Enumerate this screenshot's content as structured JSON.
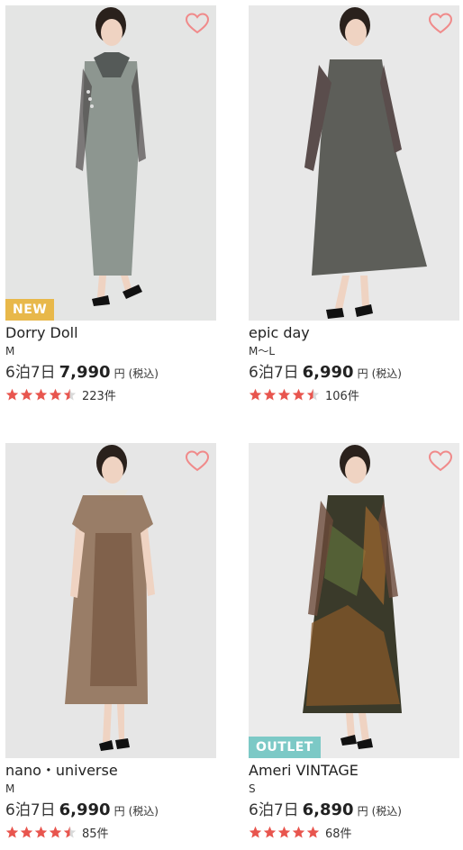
{
  "accent": {
    "heart": "#f08a8a",
    "star": "#e8554e",
    "new_badge": "#e8b84a",
    "outlet_badge": "#7cc9c6"
  },
  "products": [
    {
      "brand": "Dorry Doll",
      "size": "M",
      "plan": "6泊7日",
      "price": "7,990",
      "yen": "円",
      "tax": "(税込)",
      "rating": 4.5,
      "review_count": "223件",
      "badge": "NEW",
      "badge_color": "#e8b84a",
      "favorite_icon": "heart-outline-icon"
    },
    {
      "brand": "epic day",
      "size": "M〜L",
      "plan": "6泊7日",
      "price": "6,990",
      "yen": "円",
      "tax": "(税込)",
      "rating": 4.5,
      "review_count": "106件",
      "badge": "",
      "badge_color": "",
      "favorite_icon": "heart-outline-icon"
    },
    {
      "brand": "nano・universe",
      "size": "M",
      "plan": "6泊7日",
      "price": "6,990",
      "yen": "円",
      "tax": "(税込)",
      "rating": 4.5,
      "review_count": "85件",
      "badge": "",
      "badge_color": "",
      "favorite_icon": "heart-outline-icon"
    },
    {
      "brand": "Ameri VINTAGE",
      "size": "S",
      "plan": "6泊7日",
      "price": "6,890",
      "yen": "円",
      "tax": "(税込)",
      "rating": 5,
      "review_count": "68件",
      "badge": "OUTLET",
      "badge_color": "#7cc9c6",
      "favorite_icon": "heart-outline-icon"
    }
  ]
}
